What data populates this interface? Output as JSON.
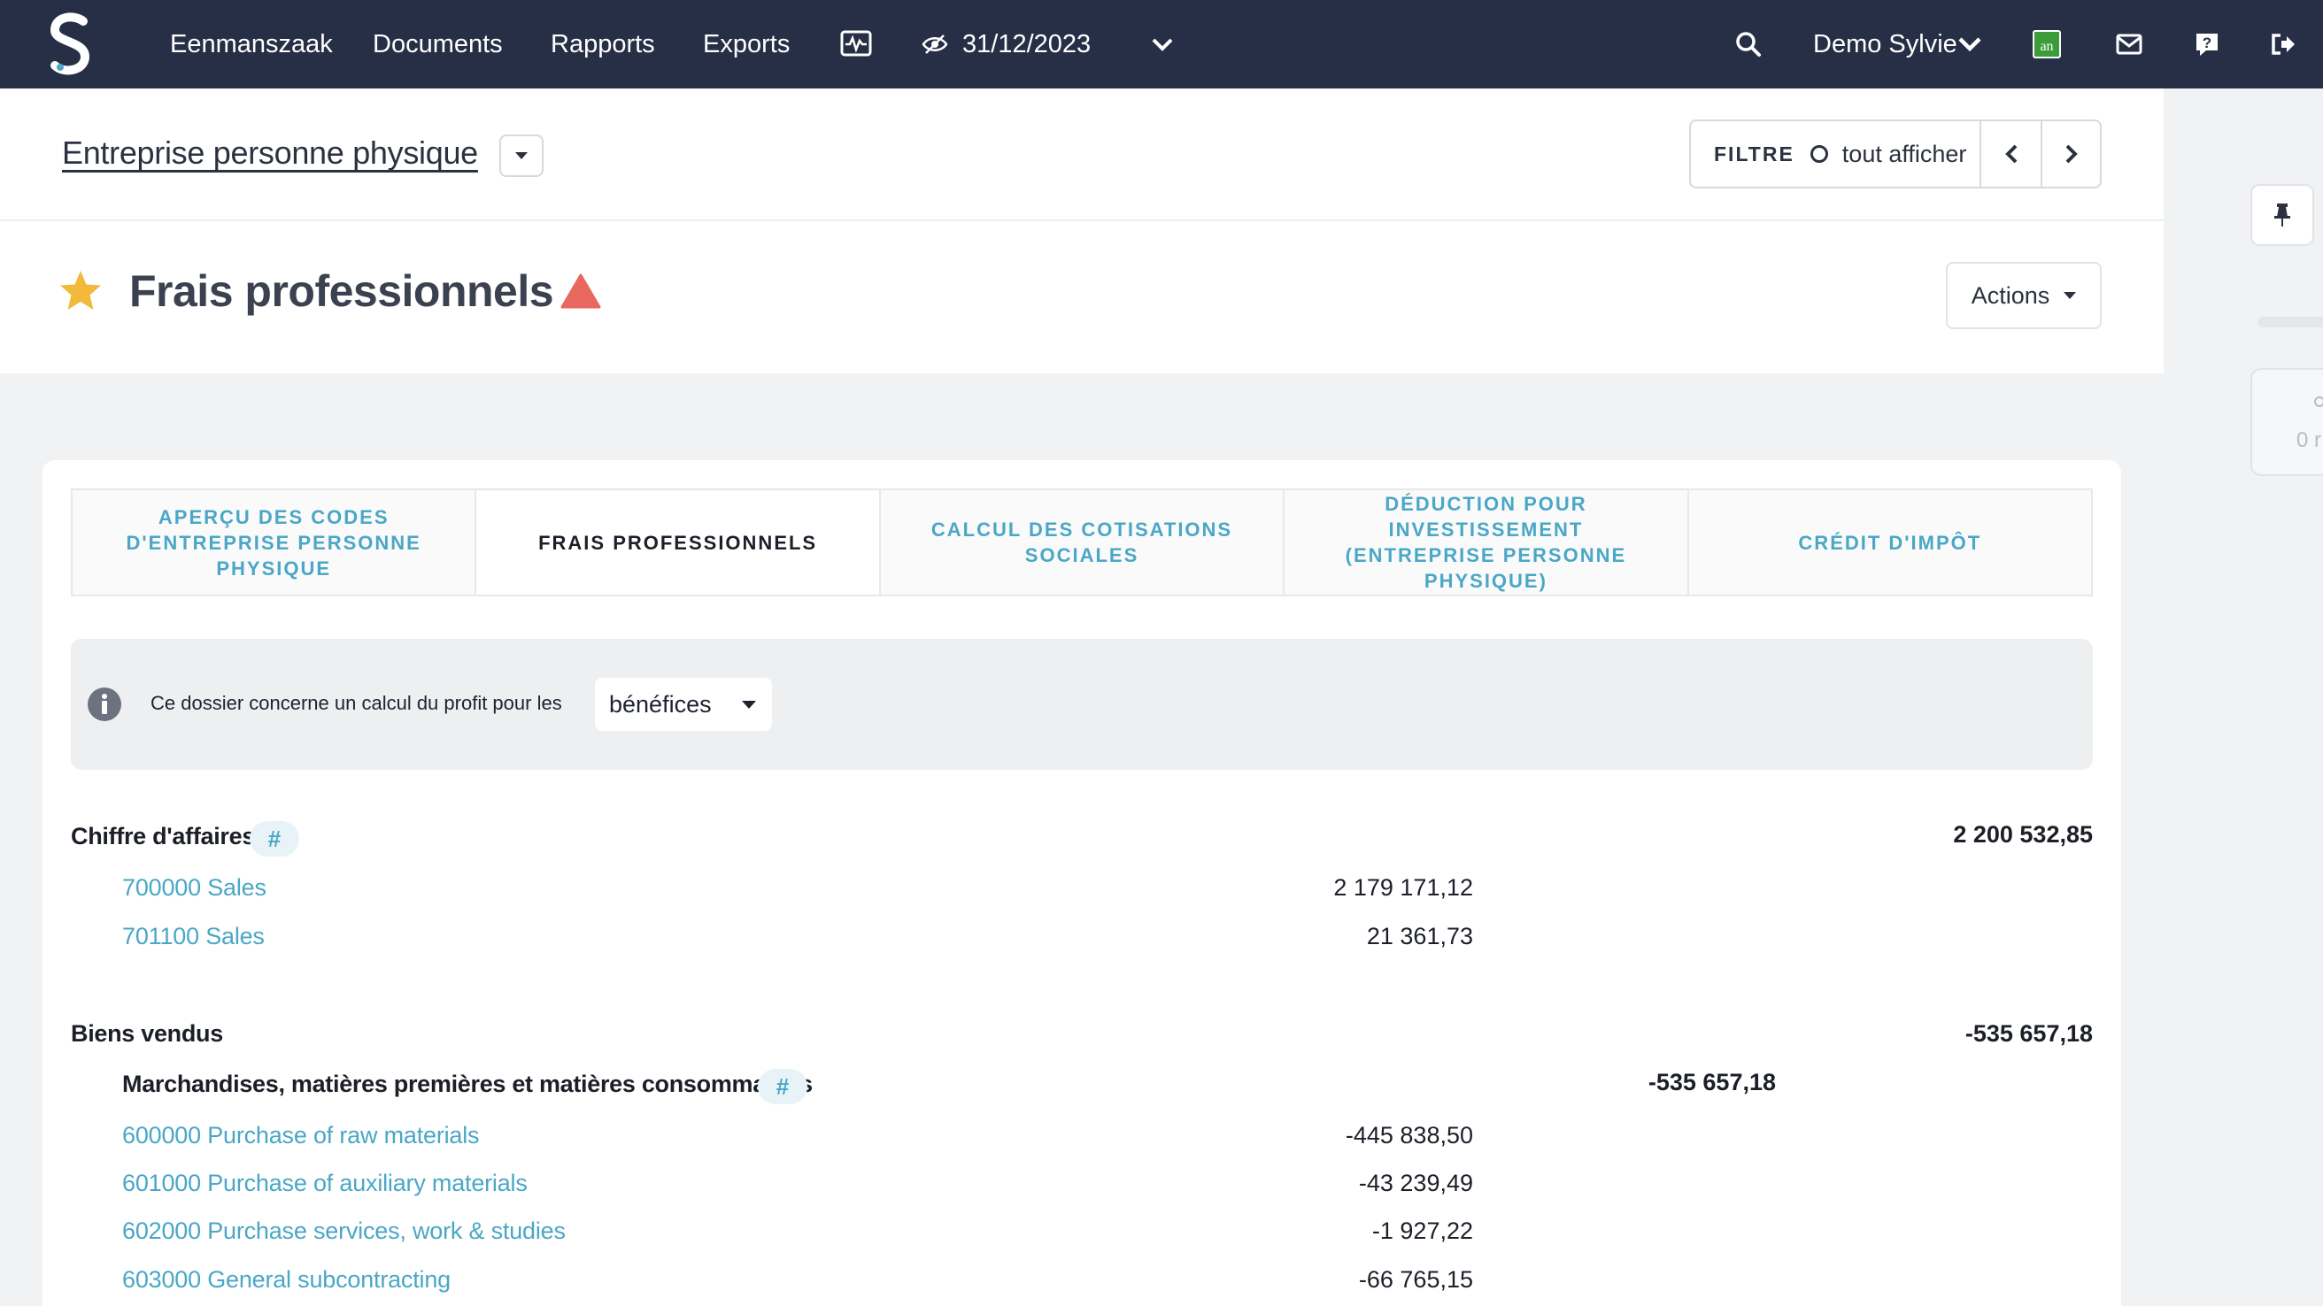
{
  "nav": {
    "links": [
      "Eenmanszaak",
      "Documents",
      "Rapports",
      "Exports"
    ],
    "period": "31/12/2023",
    "user": "Demo Sylvie",
    "brand_badge_text": "an"
  },
  "header": {
    "entity_title": "Entreprise personne physique",
    "filter_label": "FILTRE",
    "filter_value": "tout afficher",
    "page_title": "Frais professionnels",
    "actions_label": "Actions"
  },
  "tabs": [
    {
      "label": "APERÇU DES CODES D'ENTREPRISE PERSONNE PHYSIQUE",
      "active": false
    },
    {
      "label": "FRAIS PROFESSIONNELS",
      "active": true
    },
    {
      "label": "CALCUL DES COTISATIONS SOCIALES",
      "active": false
    },
    {
      "label": "DÉDUCTION POUR INVESTISSEMENT (ENTREPRISE PERSONNE PHYSIQUE)",
      "active": false
    },
    {
      "label": "CRÉDIT D'IMPÔT",
      "active": false
    }
  ],
  "info": {
    "text": "Ce dossier concerne un calcul du profit pour les",
    "select_value": "bénéfices"
  },
  "ledger": {
    "revenue": {
      "label": "Chiffre d'affaires",
      "hash": "#",
      "total": "2 200 532,85",
      "accounts": [
        {
          "label": "700000 Sales",
          "amount": "2 179 171,12"
        },
        {
          "label": "701100 Sales",
          "amount": "21 361,73"
        }
      ]
    },
    "goods": {
      "label": "Biens vendus",
      "total": "-535 657,18",
      "sub_label": "Marchandises, matières premières et matières consommables",
      "sub_hash": "#",
      "sub_total": "-535 657,18",
      "accounts": [
        {
          "label": "600000 Purchase of raw materials",
          "amount": "-445 838,50"
        },
        {
          "label": "601000 Purchase of auxiliary materials",
          "amount": "-43 239,49"
        },
        {
          "label": "602000 Purchase services, work & studies",
          "amount": "-1 927,22"
        },
        {
          "label": "603000 General subcontracting",
          "amount": "-66 765,15"
        }
      ]
    }
  },
  "side": {
    "card_text": "0 r"
  },
  "colors": {
    "nav_bg": "#262f45",
    "accent_link": "#4aa7c6",
    "star": "#f2b93b",
    "warning": "#e8675f",
    "badge_green": "#3a9d3a"
  }
}
